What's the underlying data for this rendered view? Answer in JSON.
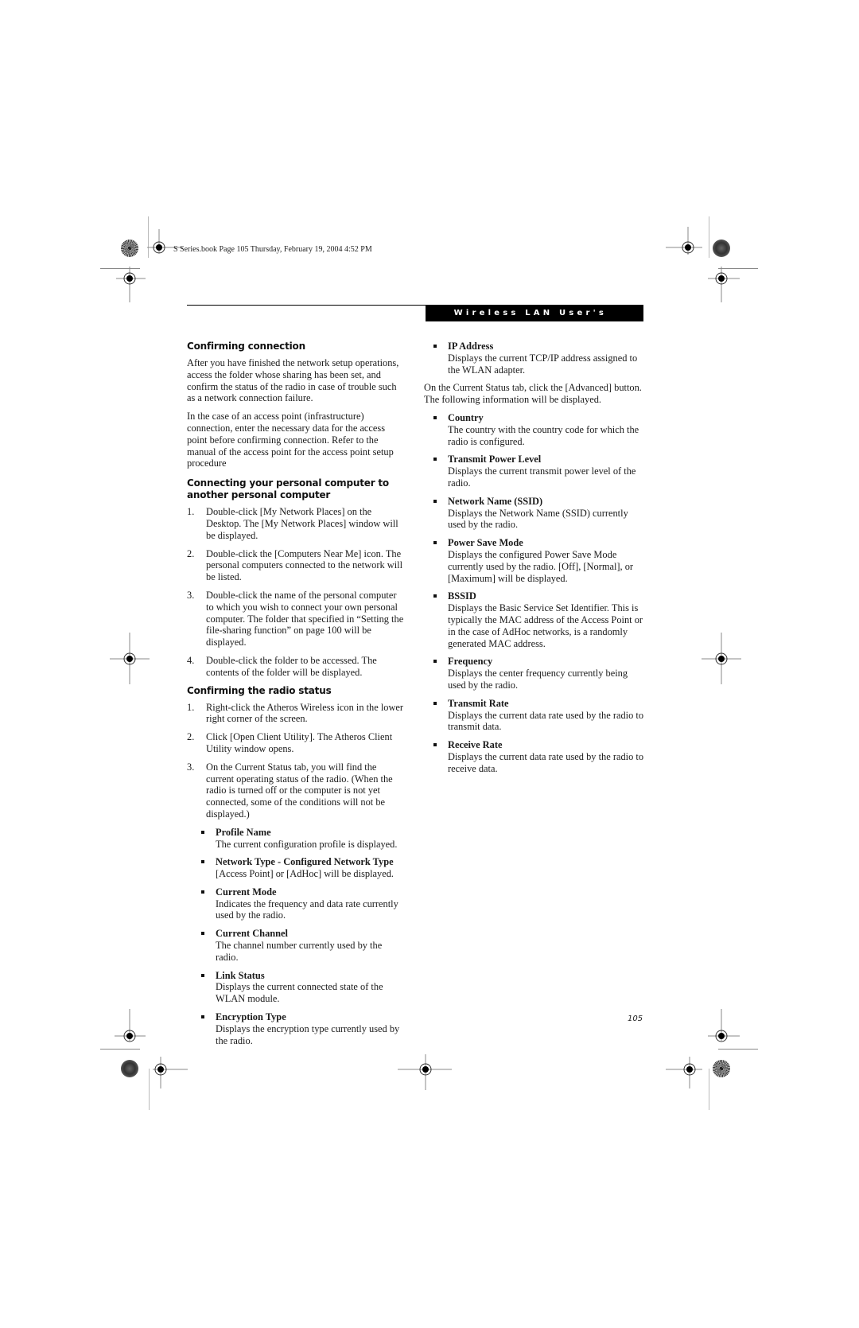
{
  "slug": "S Series.book  Page 105  Thursday, February 19, 2004  4:52 PM",
  "banner": "Wireless LAN User's Guide",
  "page_number": "105",
  "left": {
    "section1": {
      "heading": "Confirming connection",
      "paragraphs": [
        "After you have finished the network setup operations, access the folder whose sharing has been set, and confirm the status of the radio in case of trouble such as a network connection failure.",
        "In the case of an access point (infrastructure) connection, enter the necessary data for the access point before confirming connection. Refer to the manual of the access point for the access point setup procedure"
      ]
    },
    "section2": {
      "heading": "Connecting your personal computer to another personal computer",
      "steps": [
        {
          "num": "1.",
          "text": "Double-click [My Network Places] on the Desktop. The [My Network Places] window will be displayed."
        },
        {
          "num": "2.",
          "text": "Double-click the [Computers Near Me] icon. The personal computers connected to the network will be listed."
        },
        {
          "num": "3.",
          "text": "Double-click the name of the personal computer to which you wish to connect your own personal computer. The folder that specified in “Setting the file-sharing function” on page 100 will be displayed."
        },
        {
          "num": "4.",
          "text": "Double-click the folder to be accessed. The contents of the folder will be displayed."
        }
      ]
    },
    "section3": {
      "heading": "Confirming the radio status",
      "steps": [
        {
          "num": "1.",
          "text": "Right-click the Atheros Wireless icon in the lower right corner of the screen."
        },
        {
          "num": "2.",
          "text": "Click [Open Client Utility]. The Atheros Client Utility window opens."
        },
        {
          "num": "3.",
          "text": "On the Current Status tab, you will find the current operating status of the radio. (When the radio is turned off or the computer is not yet connected, some of the conditions will not be displayed.)"
        }
      ],
      "items": [
        {
          "term": "Profile Name",
          "desc": "The current configuration profile is displayed."
        },
        {
          "term": "Network Type - Configured Network Type",
          "desc": "[Access Point] or [AdHoc] will be displayed."
        },
        {
          "term": "Current Mode",
          "desc": "Indicates the frequency and data rate currently used by the radio."
        },
        {
          "term": "Current Channel",
          "desc": "The channel number currently used by the radio."
        },
        {
          "term": "Link Status",
          "desc": "Displays the current connected state of the WLAN module."
        },
        {
          "term": "Encryption Type",
          "desc": "Displays the encryption type currently used by the radio."
        }
      ]
    }
  },
  "right": {
    "items_top": [
      {
        "term": "IP Address",
        "desc": "Displays the current TCP/IP address assigned to the WLAN adapter."
      }
    ],
    "advanced_intro": "On the Current Status tab, click the [Advanced] button. The following information will be displayed.",
    "items": [
      {
        "term": "Country",
        "desc": "The country with the country code for which the radio is configured."
      },
      {
        "term": "Transmit Power Level",
        "desc": "Displays the current transmit power level of the radio."
      },
      {
        "term": "Network Name (SSID)",
        "desc": "Displays the Network Name (SSID) currently used by the radio."
      },
      {
        "term": "Power Save Mode",
        "desc": "Displays the configured Power Save Mode currently used by the radio. [Off], [Normal], or [Maximum] will be displayed."
      },
      {
        "term": "BSSID",
        "desc": "Displays the Basic Service Set Identifier. This is typically the MAC address of the Access Point or in the case of AdHoc networks, is a randomly generated MAC address."
      },
      {
        "term": "Frequency",
        "desc": "Displays the center frequency currently being used by the radio."
      },
      {
        "term": "Transmit Rate",
        "desc": "Displays the current data rate used by the radio to transmit data."
      },
      {
        "term": "Receive Rate",
        "desc": "Displays the current data rate used by the radio to receive data."
      }
    ]
  }
}
